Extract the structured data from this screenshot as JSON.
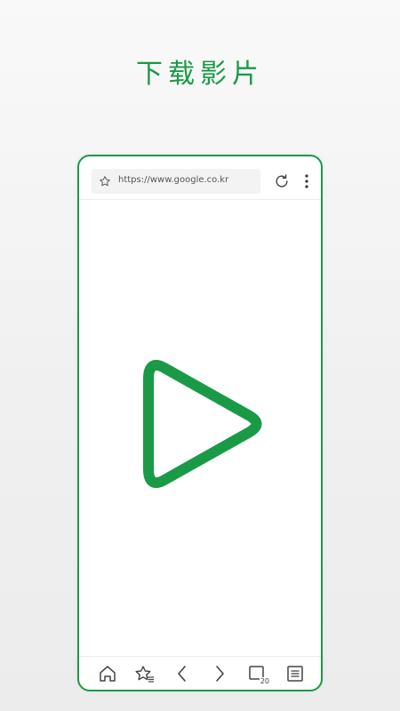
{
  "headline": "下载影片",
  "colors": {
    "accent": "#1a9a46",
    "background": "#f4f4f4",
    "icon": "#444444"
  },
  "browser": {
    "url": "https://www.google.co.kr",
    "bookmark_icon": "star-icon",
    "refresh_icon": "refresh-icon",
    "menu_icon": "more-vertical-icon"
  },
  "content": {
    "icon": "play-icon"
  },
  "toolbar": {
    "items": [
      {
        "icon": "home-icon"
      },
      {
        "icon": "bookmarks-icon"
      },
      {
        "icon": "back-icon"
      },
      {
        "icon": "forward-icon"
      },
      {
        "icon": "tabs-icon",
        "count": "20"
      },
      {
        "icon": "menu-list-icon"
      }
    ]
  }
}
